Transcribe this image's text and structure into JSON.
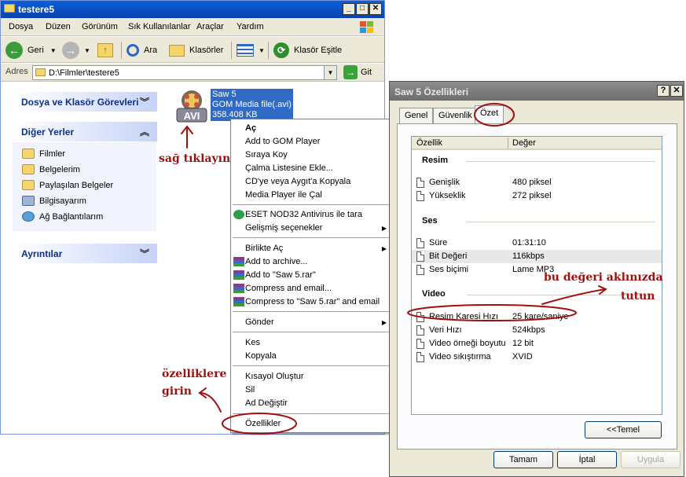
{
  "explorer": {
    "title": "testere5",
    "menu": [
      "Dosya",
      "Düzen",
      "Görünüm",
      "Sık Kullanılanlar",
      "Araçlar",
      "Yardım"
    ],
    "toolbar": {
      "back": "Geri",
      "search": "Ara",
      "folders": "Klasörler",
      "sync": "Klasör Eşitle"
    },
    "address": {
      "label": "Adres",
      "value": "D:\\Filmler\\testere5",
      "go": "Git"
    },
    "panels": {
      "tasks": "Dosya ve Klasör Görevleri",
      "other_places": "Diğer Yerler",
      "places": [
        "Filmler",
        "Belgelerim",
        "Paylaşılan Belgeler",
        "Bilgisayarım",
        "Ağ Bağlantılarım"
      ],
      "details": "Ayrıntılar"
    },
    "file": {
      "icon_text": "AVI",
      "name": "Saw 5",
      "type": "GOM Media file(.avi)",
      "size": "358.408 KB"
    }
  },
  "context_menu": {
    "items": [
      "Aç",
      "Add to GOM Player",
      "Sıraya Koy",
      "Çalma Listesine Ekle...",
      "CD'ye veya Aygıt'a Kopyala",
      "Media Player ile Çal",
      "ESET NOD32 Antivirus ile tara",
      "Gelişmiş seçenekler",
      "Birlikte Aç",
      "Add to archive...",
      "Add to \"Saw 5.rar\"",
      "Compress and email...",
      "Compress to \"Saw 5.rar\" and email",
      "Gönder",
      "Kes",
      "Kopyala",
      "Kısayol Oluştur",
      "Sil",
      "Ad Değiştir",
      "Özellikler"
    ]
  },
  "dialog": {
    "title": "Saw 5 Özellikleri",
    "title_help": "?",
    "title_close": "✕",
    "tabs": [
      "Genel",
      "Güvenlik",
      "Özet"
    ],
    "columns": [
      "Özellik",
      "Değer"
    ],
    "groups": {
      "image": "Resim",
      "audio": "Ses",
      "video": "Video"
    },
    "image_rows": [
      {
        "k": "Genişlik",
        "v": "480 piksel"
      },
      {
        "k": "Yükseklik",
        "v": "272 piksel"
      }
    ],
    "audio_rows": [
      {
        "k": "Süre",
        "v": "01:31:10"
      },
      {
        "k": "Bit Değeri",
        "v": "116kbps"
      },
      {
        "k": "Ses biçimi",
        "v": "Lame MP3"
      }
    ],
    "video_rows": [
      {
        "k": "Resim Karesi Hızı",
        "v": "25 kare/saniye"
      },
      {
        "k": "Veri Hızı",
        "v": "524kbps"
      },
      {
        "k": "Video örneği boyutu",
        "v": "12 bit"
      },
      {
        "k": "Video sıkıştırma",
        "v": "XVID"
      }
    ],
    "basic_button": "<<Temel",
    "ok": "Tamam",
    "cancel": "İptal",
    "apply": "Uygula"
  },
  "annotations": {
    "right_click": "sağ tıklayın",
    "properties_1": "özelliklere",
    "properties_2": "girin",
    "remember_1": "bu değeri aklınızda",
    "remember_2": "tutun"
  },
  "colors": {
    "annotation": "#a01010",
    "xp_blue": "#0a5fd8",
    "selection": "#316ac5"
  }
}
